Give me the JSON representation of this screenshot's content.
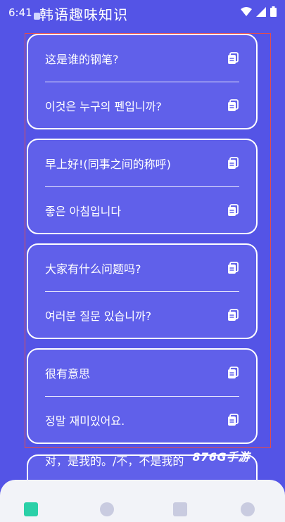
{
  "status": {
    "time": "6:41"
  },
  "app": {
    "title": "韩语趣味知识"
  },
  "watermark": "876G手游",
  "cards": [
    {
      "zh": "这是谁的钢笔?",
      "ko": "이것은 누구의 펜입니까?"
    },
    {
      "zh": "早上好!(同事之间的称呼)",
      "ko": "좋은 아침입니다"
    },
    {
      "zh": "大家有什么问题吗?",
      "ko": "여러분 질문 있습니까?"
    },
    {
      "zh": "很有意思",
      "ko": "정말 재미있어요."
    }
  ],
  "peek": {
    "zh": "对，是我的。/不，不是我的"
  },
  "colors": {
    "background": "#5454e6",
    "card": "#6060ea",
    "frame": "#e24d4d"
  }
}
